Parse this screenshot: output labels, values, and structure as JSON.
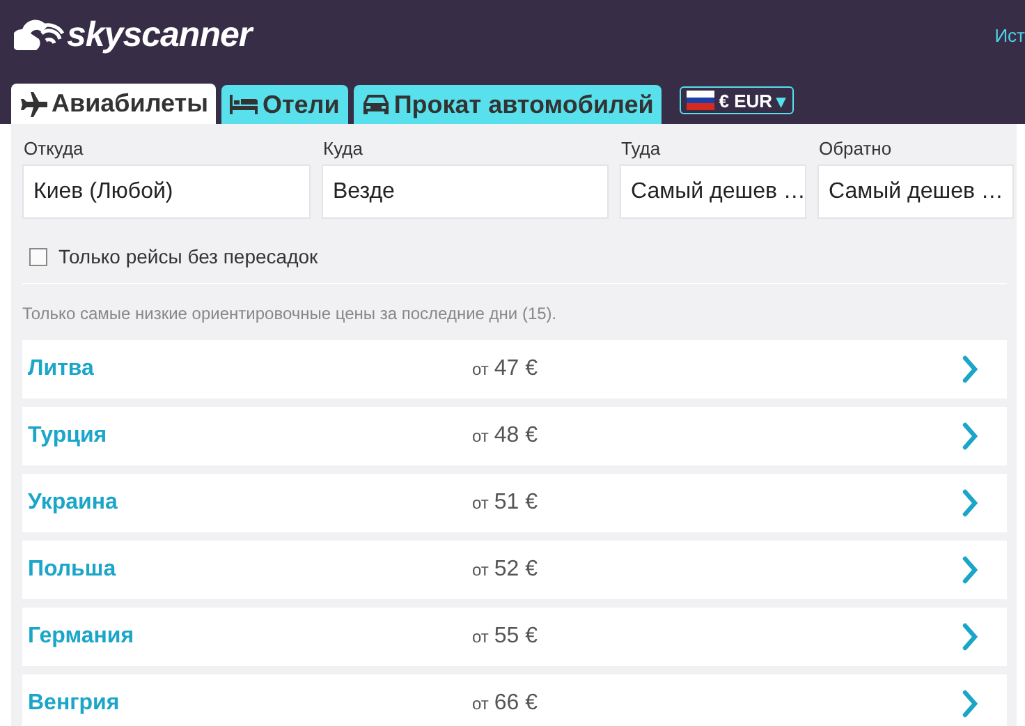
{
  "header": {
    "logo": "skyscanner",
    "link": "Ист"
  },
  "tabs": [
    {
      "label": "Авиабилеты",
      "kind": "plane",
      "selected": true
    },
    {
      "label": "Отели",
      "kind": "bed",
      "selected": false
    },
    {
      "label": "Прокат автомобилей",
      "kind": "car",
      "selected": false
    }
  ],
  "currency": {
    "label": "€ EUR",
    "caret": "▾"
  },
  "search": {
    "fields": [
      {
        "label": "Откуда",
        "value": "Киев (Любой)"
      },
      {
        "label": "Куда",
        "value": "Везде"
      },
      {
        "label": "Туда",
        "value": "Самый дешев …"
      },
      {
        "label": "Обратно",
        "value": "Самый дешев …"
      }
    ],
    "direct_only": {
      "label": "Только рейсы без пересадок",
      "checked": false
    },
    "note": "Только самые низкие ориентировочные цены за последние дни (15)."
  },
  "results": [
    {
      "country": "Литва",
      "prefix": "от",
      "price": "47 €"
    },
    {
      "country": "Турция",
      "prefix": "от",
      "price": "48 €"
    },
    {
      "country": "Украина",
      "prefix": "от",
      "price": "51 €"
    },
    {
      "country": "Польша",
      "prefix": "от",
      "price": "52 €"
    },
    {
      "country": "Германия",
      "prefix": "от",
      "price": "55 €"
    },
    {
      "country": "Венгрия",
      "prefix": "от",
      "price": "66 €"
    }
  ]
}
